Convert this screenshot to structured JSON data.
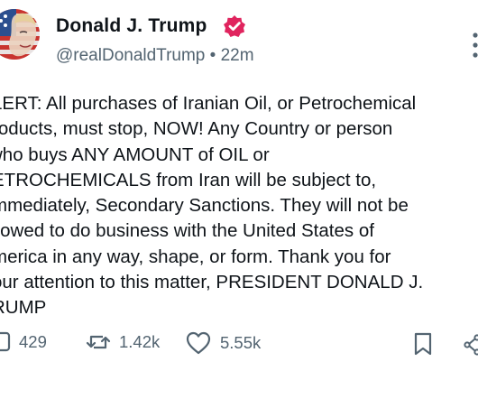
{
  "author": {
    "display_name": "Donald J. Trump",
    "handle": "@realDonaldTrump",
    "separator": "•",
    "time_ago": "22m"
  },
  "post": {
    "lines": [
      "LERT: All purchases of Iranian Oil, or Petrochemical",
      "roducts, must stop, NOW! Any Country or person",
      "who buys ANY AMOUNT of OIL or",
      "ETROCHEMICALS from Iran will be subject to,",
      "mmediately, Secondary Sanctions. They will not be",
      "llowed to do business with the United States of",
      "merica in any way, shape, or form. Thank you for",
      "our attention to this matter, PRESIDENT DONALD J.",
      "RUMP"
    ]
  },
  "metrics": {
    "replies": "429",
    "reposts": "1.42k",
    "likes": "5.55k"
  },
  "colors": {
    "text": "#0f1419",
    "secondary": "#536471",
    "verified_badge": "#e0245e"
  }
}
